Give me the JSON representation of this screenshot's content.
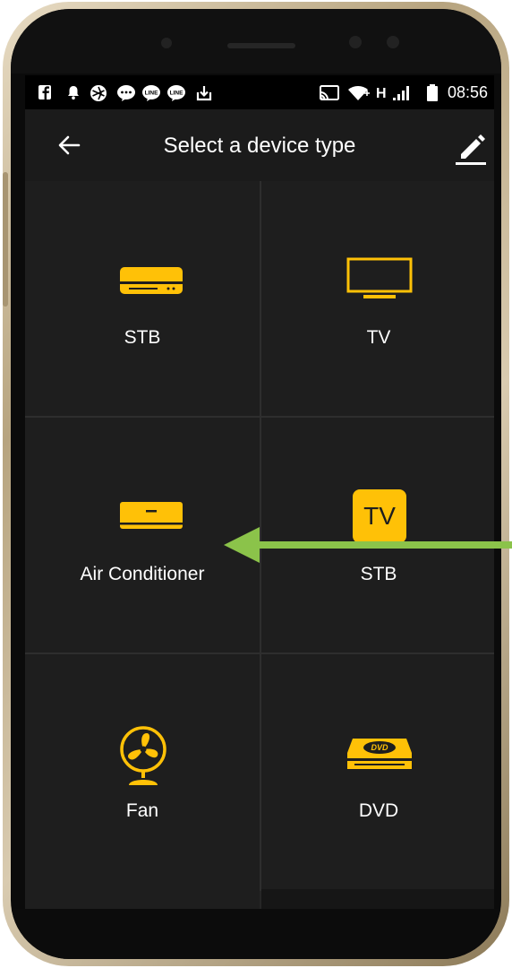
{
  "status_bar": {
    "time": "08:56",
    "network": "H",
    "left_icons": [
      "facebook-icon",
      "notification-bell-icon",
      "aperture-icon",
      "line-chat-icon",
      "line-icon",
      "download-icon"
    ],
    "right_icons": [
      "cast-icon",
      "wifi-icon",
      "signal-icon",
      "battery-icon"
    ]
  },
  "app_bar": {
    "title": "Select a device type",
    "back_icon": "arrow-left-icon",
    "edit_icon": "pencil-icon"
  },
  "device_types": [
    {
      "label": "STB",
      "icon": "set-top-box-icon"
    },
    {
      "label": "TV",
      "icon": "tv-monitor-icon"
    },
    {
      "label": "Air Conditioner",
      "icon": "air-conditioner-icon"
    },
    {
      "label": "STB",
      "icon": "tv-badge-icon",
      "icon_text": "TV"
    },
    {
      "label": "Fan",
      "icon": "fan-icon"
    },
    {
      "label": "DVD",
      "icon": "dvd-player-icon",
      "icon_text": "DVD"
    }
  ],
  "colors": {
    "accent": "#FFC107",
    "background": "#1E1E1E",
    "app_bar": "#1B1B1B",
    "status_bar": "#000000",
    "annotation_arrow": "#8BC34A"
  }
}
